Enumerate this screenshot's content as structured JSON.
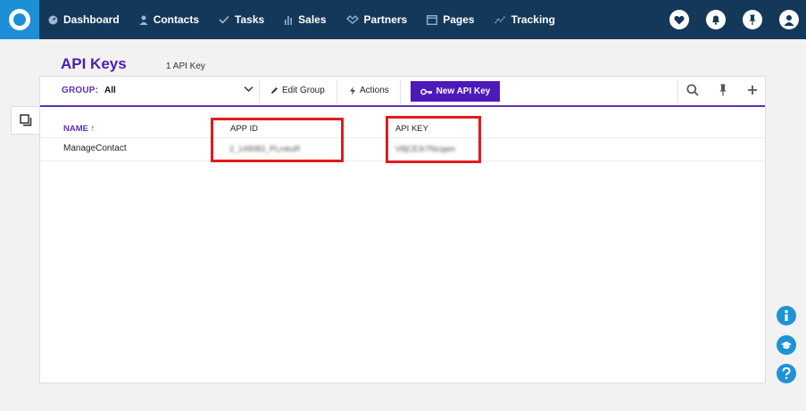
{
  "nav": {
    "items": [
      {
        "label": "Dashboard",
        "icon": "speedometer-icon"
      },
      {
        "label": "Contacts",
        "icon": "person-icon"
      },
      {
        "label": "Tasks",
        "icon": "check-icon"
      },
      {
        "label": "Sales",
        "icon": "bar-chart-icon"
      },
      {
        "label": "Partners",
        "icon": "handshake-icon"
      },
      {
        "label": "Pages",
        "icon": "browser-icon"
      },
      {
        "label": "Tracking",
        "icon": "trend-line-icon"
      }
    ],
    "right_icons": [
      "heart-icon",
      "bell-icon",
      "pin-icon",
      "user-avatar-icon"
    ]
  },
  "page": {
    "title": "API Keys",
    "count": "1 API Key"
  },
  "toolbar": {
    "group_label": "GROUP:",
    "group_value": "All",
    "edit_group": "Edit Group",
    "actions": "Actions",
    "new_key": "New API Key"
  },
  "table": {
    "headers": {
      "name": "NAME ↑",
      "app_id": "APP ID",
      "api_key": "API KEY"
    },
    "rows": [
      {
        "name": "ManageContact",
        "app_id": "2_149083_PLmkuR",
        "api_key": "V8jCE3r7Ncqam"
      }
    ]
  },
  "colors": {
    "topbar": "#14385a",
    "accent": "#4b1ab8",
    "logo": "#1d8fd6",
    "highlight": "#e01c1c",
    "help": "#1e93d6"
  }
}
